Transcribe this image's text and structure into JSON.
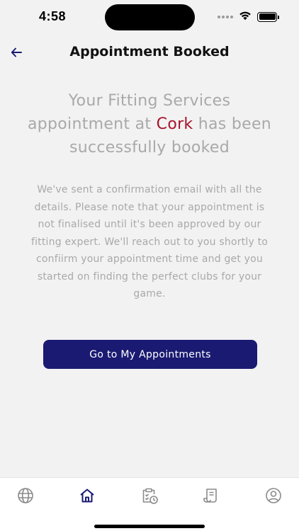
{
  "status_bar": {
    "time": "4:58"
  },
  "header": {
    "title": "Appointment Booked",
    "back_icon": "arrow-left-icon"
  },
  "confirmation": {
    "headline_before": "Your Fitting Services appointment at ",
    "location": "Cork",
    "headline_after": " has been successfully booked",
    "body": "We've sent a confirmation email with all the details. Please note that your appointment is not finalised until it's been approved by our fitting expert. We'll reach out to you shortly to confiirm your appointment time and get you started on finding the perfect clubs for your game.",
    "button_label": "Go to My Appointments"
  },
  "tab_bar": {
    "active": "home",
    "items": [
      {
        "id": "globe",
        "icon": "globe-icon"
      },
      {
        "id": "home",
        "icon": "home-icon"
      },
      {
        "id": "appointments",
        "icon": "clipboard-clock-icon"
      },
      {
        "id": "receipts",
        "icon": "receipt-icon"
      },
      {
        "id": "profile",
        "icon": "user-circle-icon"
      }
    ]
  },
  "colors": {
    "primary": "#1a1a72",
    "accent": "#a8132a",
    "muted_text": "#a9a9a9",
    "background": "#f2f2f2",
    "tab_inactive": "#8a8a8a"
  }
}
